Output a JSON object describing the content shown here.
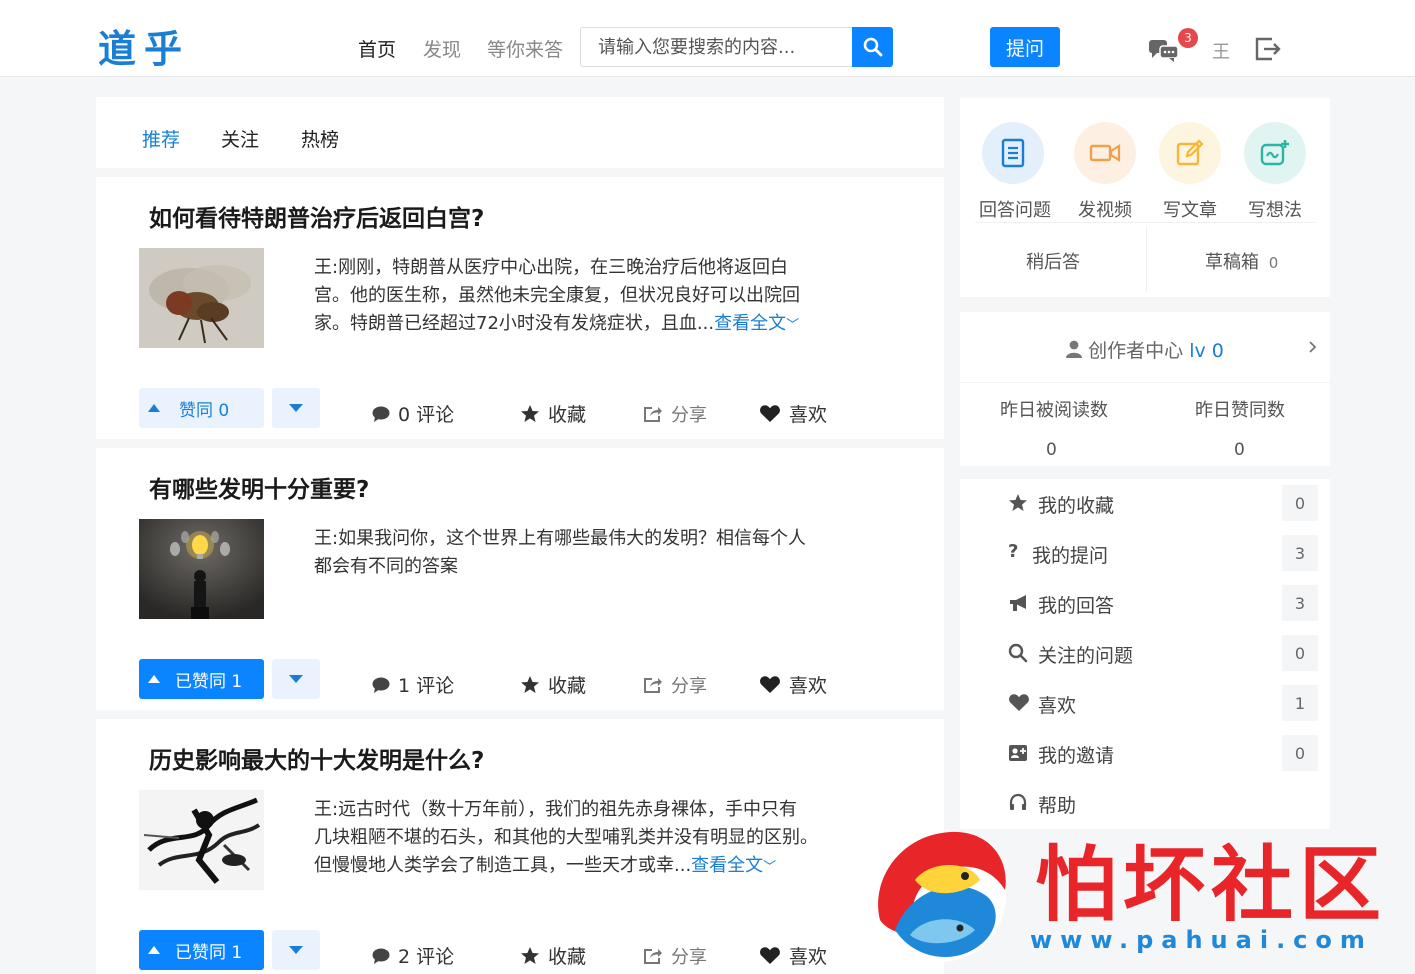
{
  "header": {
    "logo": "道乎",
    "nav": [
      "首页",
      "发现",
      "等你来答"
    ],
    "search_placeholder": "请输入您要搜索的内容...",
    "ask_label": "提问",
    "notification_count": "3",
    "user_name": "王"
  },
  "feed": {
    "tabs": [
      "推荐",
      "关注",
      "热榜"
    ],
    "posts": [
      {
        "title": "如何看待特朗普治疗后返回白宫?",
        "excerpt_lines": [
          "王:刚刚，特朗普从医疗中心出院，在三晚治疗后他将返回白",
          "宫。他的医生称，虽然他未完全康复，但状况良好可以出院回",
          "家。特朗普已经超过72小时没有发烧症状，且血..."
        ],
        "read_more": "查看全文",
        "vote_label": "赞同 0",
        "comments": "0 评论"
      },
      {
        "title": "有哪些发明十分重要?",
        "excerpt_lines": [
          "王:如果我问你，这个世界上有哪些最伟大的发明？相信每个人",
          "都会有不同的答案"
        ],
        "read_more": "",
        "vote_label": "已赞同 1",
        "comments": "1 评论"
      },
      {
        "title": "历史影响最大的十大发明是什么?",
        "excerpt_lines": [
          "王:远古时代（数十万年前），我们的祖先赤身裸体，手中只有",
          "几块粗陋不堪的石头，和其他的大型哺乳类并没有明显的区别。",
          "但慢慢地人类学会了制造工具，一些天才或幸..."
        ],
        "read_more": "查看全文",
        "vote_label": "已赞同 1",
        "comments": "2 评论"
      }
    ],
    "actions": {
      "collect": "收藏",
      "share": "分享",
      "like": "喜欢"
    }
  },
  "sidebar": {
    "quick_actions": [
      {
        "label": "回答问题",
        "icon": "document-icon",
        "color": "#1a7fd4"
      },
      {
        "label": "发视频",
        "icon": "video-icon",
        "color": "#f0a04b"
      },
      {
        "label": "写文章",
        "icon": "edit-icon",
        "color": "#f5b73b"
      },
      {
        "label": "写想法",
        "icon": "idea-icon",
        "color": "#2bb5a4"
      }
    ],
    "later": "稍后答",
    "drafts": "草稿箱",
    "drafts_count": "0",
    "creator_center": "创作者中心",
    "creator_level": "lv 0",
    "stats": [
      {
        "label": "昨日被阅读数",
        "value": "0"
      },
      {
        "label": "昨日赞同数",
        "value": "0"
      }
    ],
    "menu": [
      {
        "label": "我的收藏",
        "count": "0",
        "icon": "star-icon"
      },
      {
        "label": "我的提问",
        "count": "3",
        "icon": "question-icon"
      },
      {
        "label": "我的回答",
        "count": "3",
        "icon": "bullhorn-icon"
      },
      {
        "label": "关注的问题",
        "count": "0",
        "icon": "search-icon"
      },
      {
        "label": "喜欢",
        "count": "1",
        "icon": "heart-icon"
      },
      {
        "label": "我的邀请",
        "count": "0",
        "icon": "invite-icon"
      },
      {
        "label": "帮助",
        "count": "",
        "icon": "headset-icon"
      }
    ]
  },
  "watermark": {
    "text": "怕坏社区",
    "url": "www.pahuai.com"
  },
  "colors": {
    "accent": "#0a84ff",
    "link": "#1a7fd4",
    "badge": "#e8474c"
  }
}
